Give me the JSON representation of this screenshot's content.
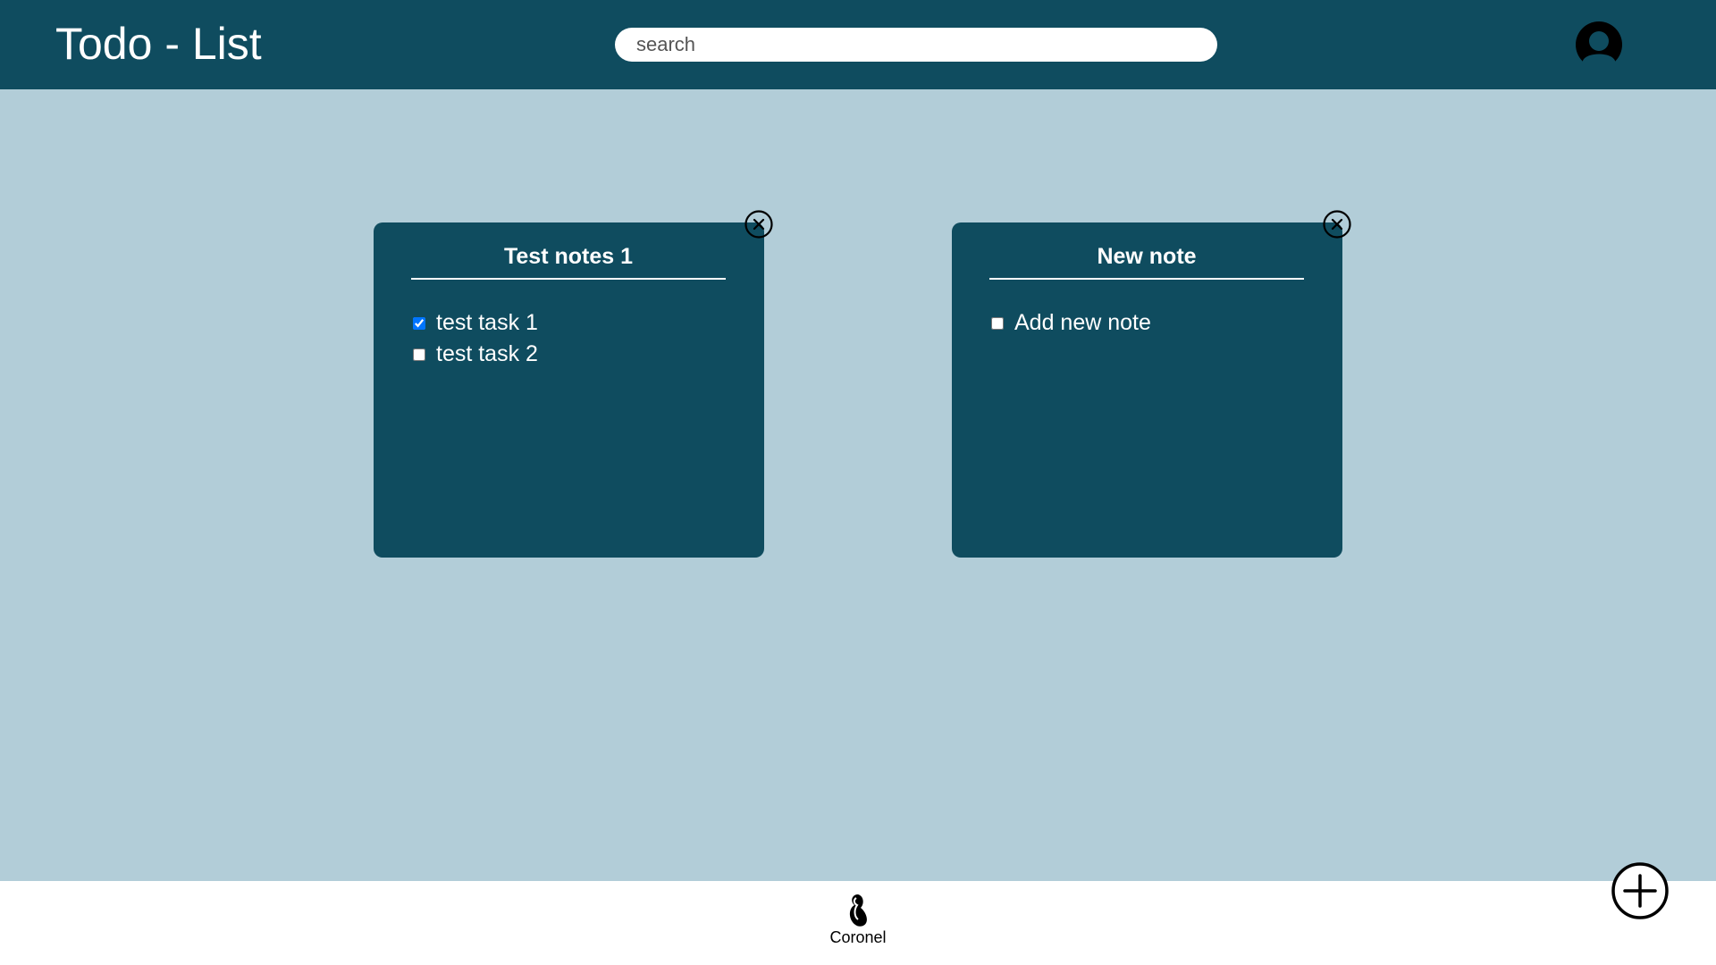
{
  "header": {
    "title": "Todo - List",
    "search_placeholder": "search",
    "search_value": ""
  },
  "notes": [
    {
      "title": "Test notes 1",
      "tasks": [
        {
          "label": "test task 1",
          "checked": true
        },
        {
          "label": "test task 2",
          "checked": false
        }
      ]
    },
    {
      "title": "New note",
      "tasks": [
        {
          "label": "Add new note",
          "checked": false
        }
      ]
    }
  ],
  "footer": {
    "brand_name": "Coronel"
  },
  "icons": {
    "avatar": "user-avatar-icon",
    "close": "close-circle-icon",
    "add": "add-circle-icon",
    "logo": "coronel-logo-icon"
  },
  "colors": {
    "header_bg": "#0f4c5f",
    "main_bg": "#b2cdd8",
    "card_bg": "#0f4c5f",
    "footer_bg": "#ffffff"
  }
}
